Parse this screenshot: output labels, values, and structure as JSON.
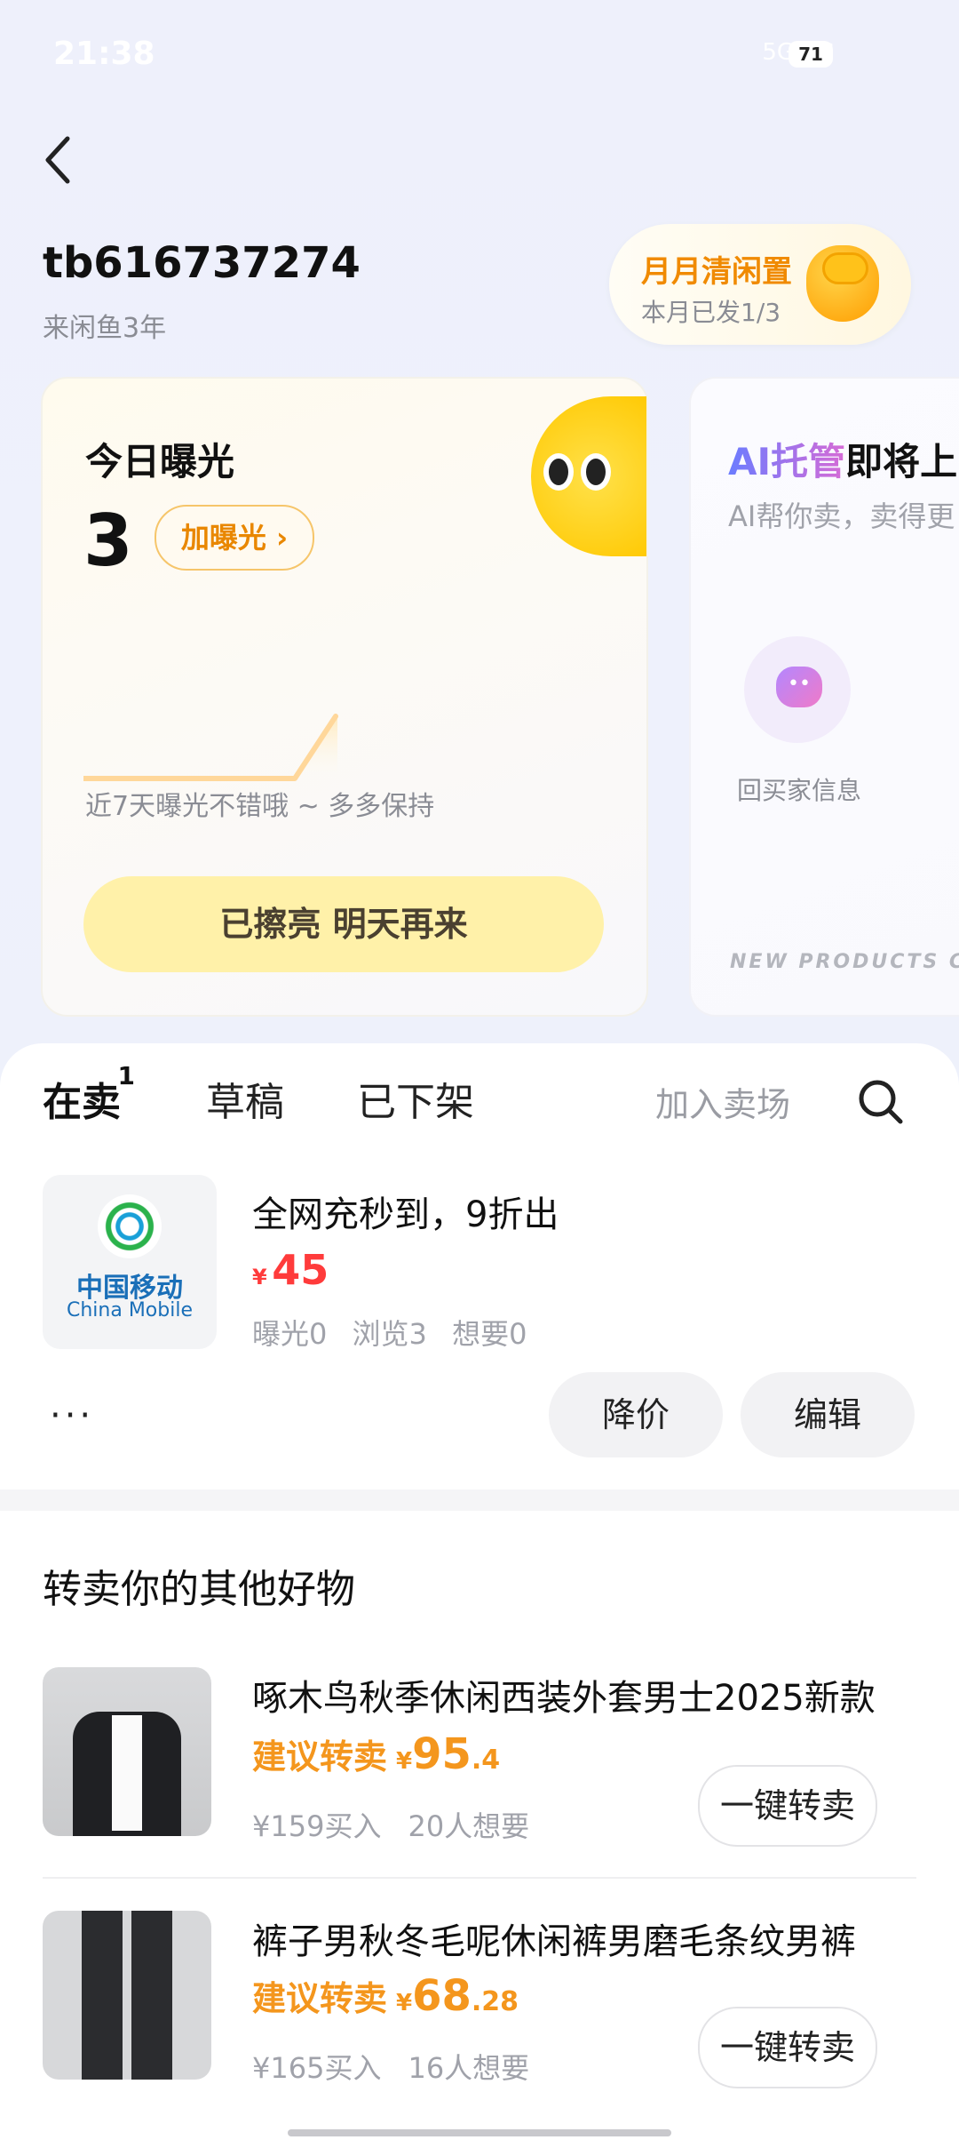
{
  "status_bar": {
    "time": "21:38",
    "battery": "71",
    "network": "5G 5G"
  },
  "header": {
    "username": "tb616737274",
    "since": "来闲鱼3年"
  },
  "promo": {
    "title": "月月清闲置",
    "subtitle": "本月已发1/3"
  },
  "exposure_card": {
    "title": "今日曝光",
    "count": "3",
    "boost_label": "加曝光 ›",
    "hint": "近7天曝光不错哦 ~ 多多保持",
    "button": "已擦亮 明天再来"
  },
  "ai_card": {
    "title_ai": "AI托管",
    "title_rest": "即将上",
    "subtitle": "AI帮你卖，卖得更",
    "reply_label": "回买家信息",
    "footer": "NEW PRODUCTS CO"
  },
  "tabs": [
    {
      "label": "在卖",
      "badge": "1"
    },
    {
      "label": "草稿"
    },
    {
      "label": "已下架"
    }
  ],
  "join_market": "加入卖场",
  "listing": {
    "brand_cn": "中国移动",
    "brand_en": "China Mobile",
    "title": "全网充秒到，9折出",
    "currency": "¥",
    "price": "45",
    "exposure": "曝光0",
    "views": "浏览3",
    "wants": "想要0",
    "more": "···",
    "price_drop": "降价",
    "edit": "编辑"
  },
  "resell": {
    "title": "转卖你的其他好物",
    "items": [
      {
        "name": "啄木鸟秋季休闲西装外套男士2025新款",
        "label": "建议转卖",
        "currency": "¥",
        "price_int": "95",
        "price_dec": ".4",
        "bought": "¥159买入",
        "wants": "20人想要",
        "button": "一键转卖"
      },
      {
        "name": "裤子男秋冬毛呢休闲裤男磨毛条纹男裤",
        "label": "建议转卖",
        "currency": "¥",
        "price_int": "68",
        "price_dec": ".28",
        "bought": "¥165买入",
        "wants": "16人想要",
        "button": "一键转卖"
      }
    ]
  }
}
